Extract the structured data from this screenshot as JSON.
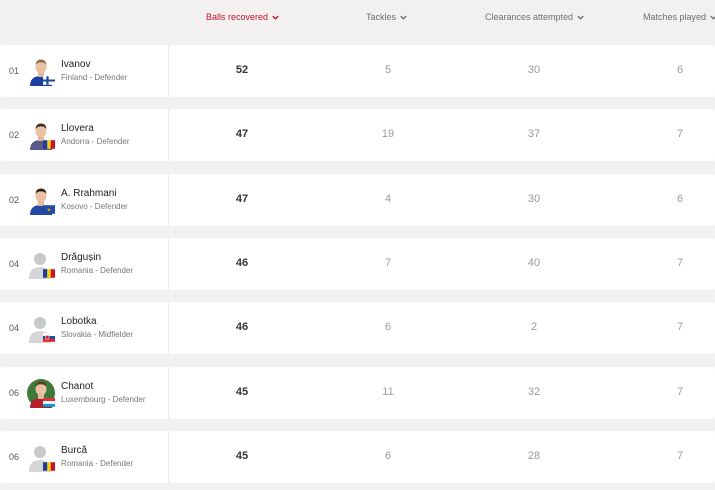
{
  "columns": [
    {
      "label": "Balls recovered",
      "active": true
    },
    {
      "label": "Tackles",
      "active": false
    },
    {
      "label": "Clearances attempted",
      "active": false
    },
    {
      "label": "Matches played",
      "active": false
    }
  ],
  "colors": {
    "accent": "#c8102e",
    "row_bg": "#ffffff",
    "page_bg": "#f2f1ef"
  },
  "rows": [
    {
      "rank": "01",
      "name": "Ivanov",
      "sub": "Finland - Defender",
      "flag": "finland-flag-icon",
      "avatar": "player-photo",
      "balls": "52",
      "tackles": "5",
      "clearances": "30",
      "matches": "6"
    },
    {
      "rank": "02",
      "name": "Llovera",
      "sub": "Andorra - Defender",
      "flag": "andorra-flag-icon",
      "avatar": "player-photo",
      "balls": "47",
      "tackles": "19",
      "clearances": "37",
      "matches": "7"
    },
    {
      "rank": "02",
      "name": "A. Rrahmani",
      "sub": "Kosovo - Defender",
      "flag": "kosovo-flag-icon",
      "avatar": "player-photo",
      "balls": "47",
      "tackles": "4",
      "clearances": "30",
      "matches": "6"
    },
    {
      "rank": "04",
      "name": "Drăgușin",
      "sub": "Romania - Defender",
      "flag": "romania-flag-icon",
      "avatar": "placeholder-avatar",
      "balls": "46",
      "tackles": "7",
      "clearances": "40",
      "matches": "7"
    },
    {
      "rank": "04",
      "name": "Lobotka",
      "sub": "Slovakia - Midfielder",
      "flag": "slovakia-flag-icon",
      "avatar": "placeholder-avatar",
      "balls": "46",
      "tackles": "6",
      "clearances": "2",
      "matches": "7"
    },
    {
      "rank": "06",
      "name": "Chanot",
      "sub": "Luxembourg - Defender",
      "flag": "luxembourg-flag-icon",
      "avatar": "player-photo",
      "balls": "45",
      "tackles": "11",
      "clearances": "32",
      "matches": "7"
    },
    {
      "rank": "06",
      "name": "Burcă",
      "sub": "Romania - Defender",
      "flag": "romania-flag-icon",
      "avatar": "placeholder-avatar",
      "balls": "45",
      "tackles": "6",
      "clearances": "28",
      "matches": "7"
    }
  ]
}
